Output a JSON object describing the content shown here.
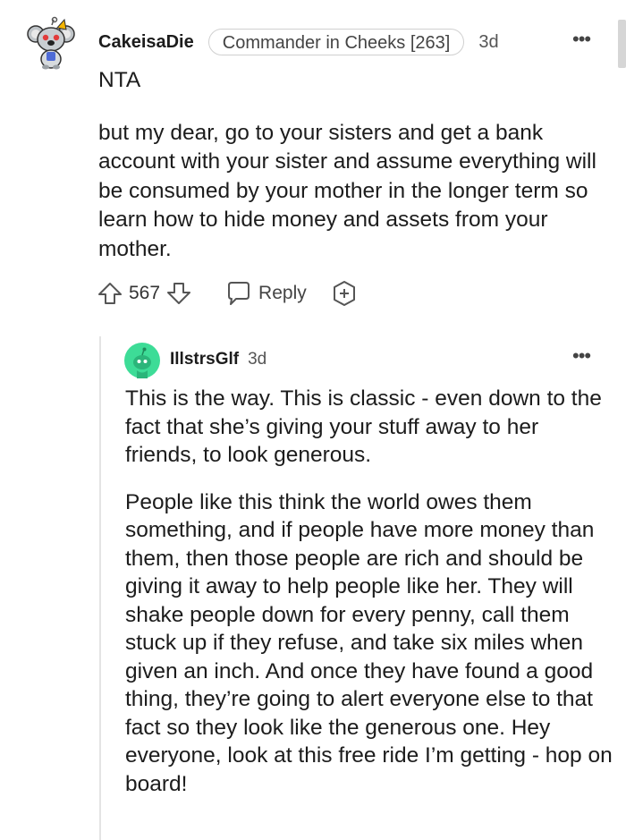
{
  "comment": {
    "username": "CakeisaDie",
    "flair": "Commander in Cheeks [263]",
    "timestamp": "3d",
    "more_label": "•••",
    "paragraphs": [
      "NTA",
      "but my dear, go to your sisters and get a bank account with your sister and assume everything will be consumed by your mother in the longer term so learn how to hide money and assets from your mother."
    ],
    "vote_count": "567",
    "reply_label": "Reply",
    "avatar_icon": "koala-snoo-avatar-icon",
    "upvote_icon": "arrow-up-outline-icon",
    "downvote_icon": "arrow-down-outline-icon",
    "reply_icon": "speech-bubble-icon",
    "award_icon": "plus-award-icon"
  },
  "reply": {
    "username": "IllstrsGlf",
    "timestamp": "3d",
    "more_label": "•••",
    "avatar_icon": "green-snoo-avatar-icon",
    "paragraphs": [
      "This is the way. This is classic - even down to the fact that she’s giving your stuff away to her friends, to look generous.",
      "People like this think the world owes them something, and if people have more money than them, then those people are rich and should be giving it away to help people like her. They will shake people down for every penny, call them stuck up if they refuse, and take six miles when given an inch. And once they have found a good thing, they’re going to alert everyone else to that fact so they look like the generous one. Hey everyone, look at this free ride I’m getting - hop on board!"
    ]
  },
  "colors": {
    "text": "#1c1c1c",
    "meta": "#555555",
    "thread_line": "#e4e4e4",
    "reply_avatar_bg": "#3ddc97"
  }
}
